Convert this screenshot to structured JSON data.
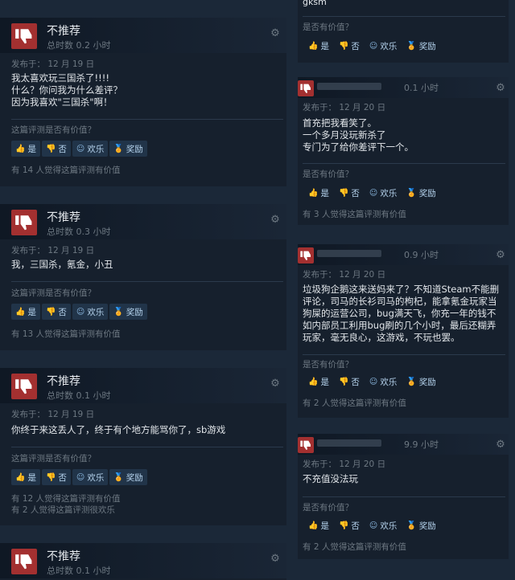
{
  "labels": {
    "not_recommended": "不推荐",
    "was_helpful": "这篇评测是否有价值？",
    "was_helpful_short": "是否有价值？",
    "yes": "是",
    "no": "否",
    "funny": "欢乐",
    "award": "奖励",
    "gear": "⚙"
  },
  "left_reviews": [
    {
      "hours": "总时数 0.2 小时",
      "posted": "发布于：  12 月 19 日",
      "text": "我太喜欢玩三国杀了!!!!\n什么？你问我为什么差评？\n因为我喜欢\"三国杀\"啊！",
      "found": [
        "有 14 人觉得这篇评测有价值"
      ]
    },
    {
      "hours": "总时数 0.3 小时",
      "posted": "发布于：  12 月 19 日",
      "text": "我，三国杀，氪金，小丑",
      "found": [
        "有 13 人觉得这篇评测有价值"
      ]
    },
    {
      "hours": "总时数 0.1 小时",
      "posted": "发布于：  12 月 19 日",
      "text": "你终于来这丢人了，终于有个地方能骂你了，sb游戏",
      "found": [
        "有 12 人觉得这篇评测有价值",
        "有 2 人觉得这篇评测很欢乐"
      ]
    },
    {
      "hours": "总时数 0.1 小时"
    }
  ],
  "right_top": {
    "partial_text": "gksm"
  },
  "right_reviews": [
    {
      "hours": "0.1 小时",
      "posted": "发布于：  12 月 20 日",
      "text": "首充把我看笑了。\n一个多月没玩新杀了\n专门为了给你差评下一个。",
      "found": [
        "有 3 人觉得这篇评测有价值"
      ]
    },
    {
      "hours": "0.9 小时",
      "posted": "发布于：  12 月 20 日",
      "text": "垃圾狗企鹅这来送妈来了？不知道Steam不能删评论，司马的长衫司马的枸杞，能拿氪金玩家当狗屎的运营公司，bug满天飞，你充一年的钱不如内部员工利用bug刷的几个小时，最后还糊弄玩家，毫无良心，这游戏，不玩也罢。",
      "found": [
        "有 2 人觉得这篇评测有价值"
      ]
    },
    {
      "hours": "9.9 小时",
      "posted": "发布于：  12 月 20 日",
      "text": "不充值没法玩",
      "found": [
        "有 2 人觉得这篇评测有价值"
      ]
    }
  ]
}
